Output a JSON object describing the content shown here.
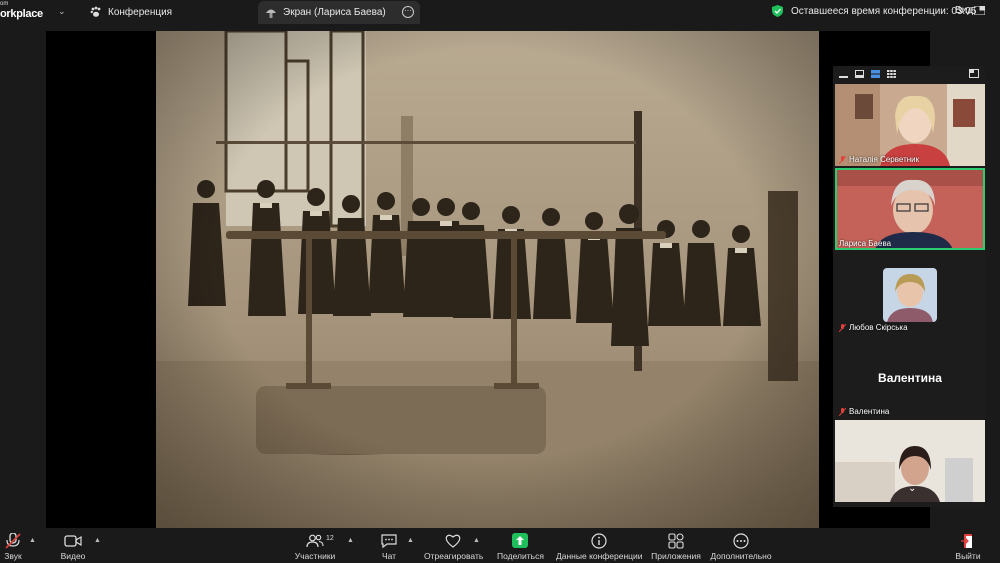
{
  "topbar": {
    "brand_small": "om",
    "brand_large": "orkplace",
    "conference_tab": "Конференция",
    "share_tab": "Экран (Лариса Баева)",
    "timer_label": "Оставшееся время конференции: 03:05",
    "view_label": "Вид"
  },
  "participants": {
    "tiles": [
      {
        "name": "Наталія Серветник",
        "muted": true
      },
      {
        "name": "Лариса Баева",
        "muted": false,
        "active": true
      },
      {
        "name": "Любов Скірська",
        "muted": true
      },
      {
        "name": "Валентина",
        "muted": true,
        "display_name": "Валентина"
      },
      {
        "name": "",
        "muted": false
      }
    ]
  },
  "toolbar": {
    "audio": "Звук",
    "video": "Видео",
    "participants": "Участники",
    "participants_count": "12",
    "chat": "Чат",
    "react": "Отреагировать",
    "share": "Поделиться",
    "meeting_info": "Данные конференции",
    "apps": "Приложения",
    "more": "Дополнительно",
    "leave": "Выйти"
  },
  "colors": {
    "accent_green": "#1fbf5b",
    "active_border": "#2ecc71",
    "muted_red": "#e0413c",
    "background": "#1a1a1a"
  }
}
